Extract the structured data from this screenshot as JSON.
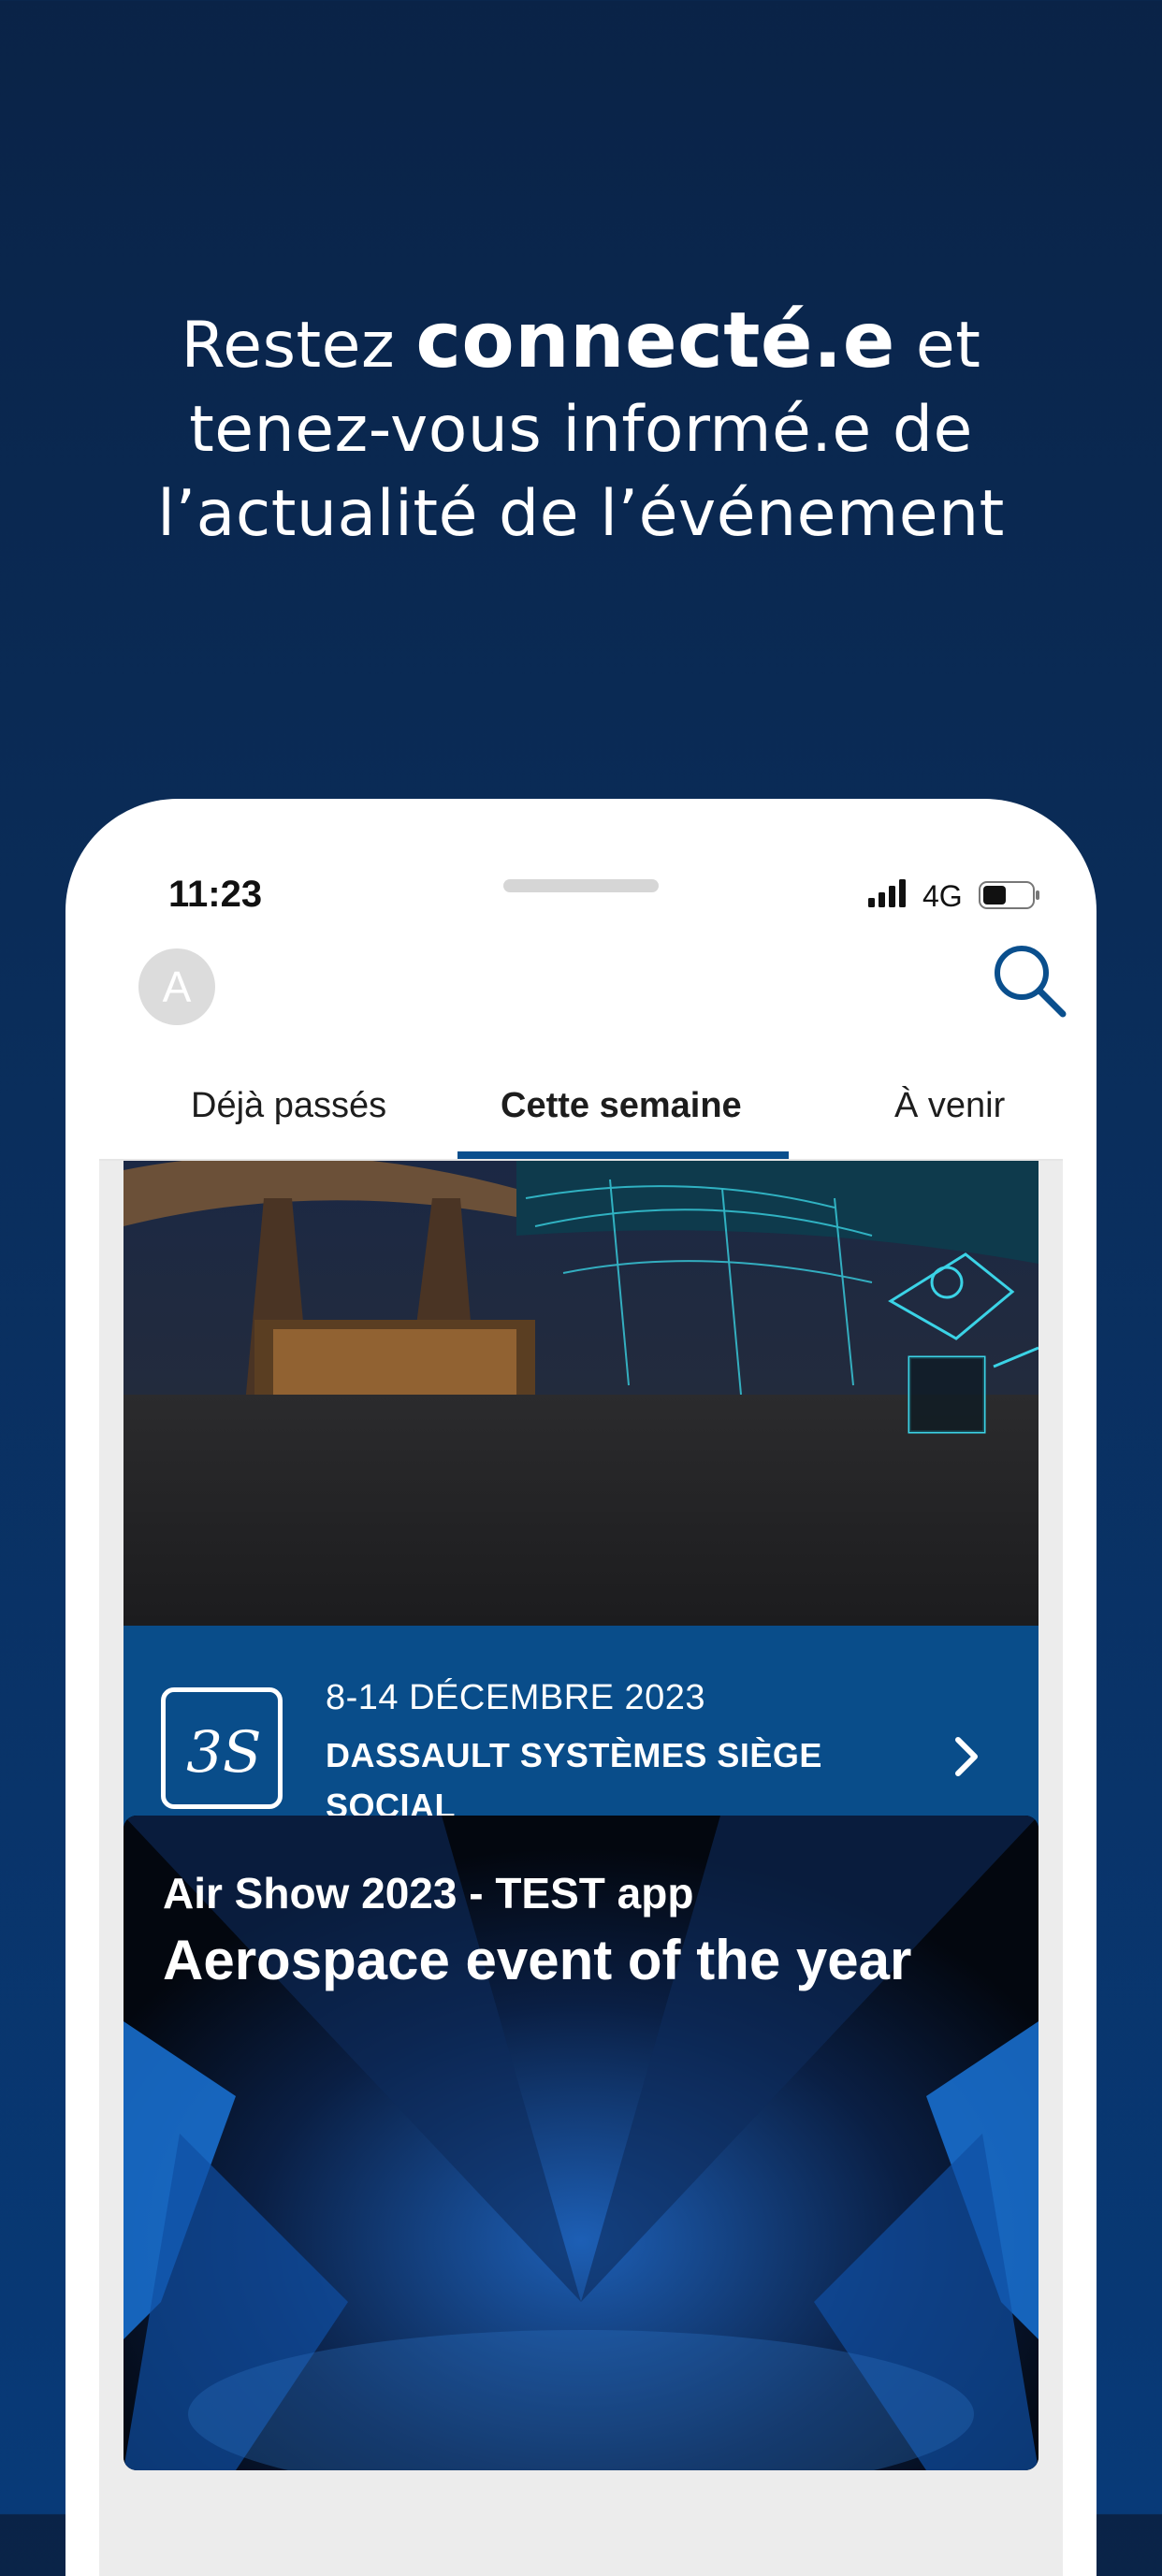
{
  "marketing": {
    "line1_pre": "Restez ",
    "line1_bold": "connecté.e",
    "line1_post": " et",
    "line2": "tenez-vous informé.e de",
    "line3": "l’actualité de l’événement"
  },
  "status_bar": {
    "time": "11:23",
    "network": "4G"
  },
  "header": {
    "avatar_initial": "A"
  },
  "tabs": [
    {
      "label": "Déjà passés"
    },
    {
      "label": "Cette semaine"
    },
    {
      "label": "À venir"
    }
  ],
  "events": [
    {
      "date": "8-14 DÉCEMBRE 2023",
      "venue": "DASSAULT SYSTÈMES SIÈGE SOCIAL"
    },
    {
      "title": "Air Show 2023 - TEST app",
      "subtitle": "Aerospace event of the year"
    }
  ],
  "colors": {
    "accent": "#0a4f8d",
    "background_top": "#0a2347",
    "background_bottom": "#083a78"
  }
}
